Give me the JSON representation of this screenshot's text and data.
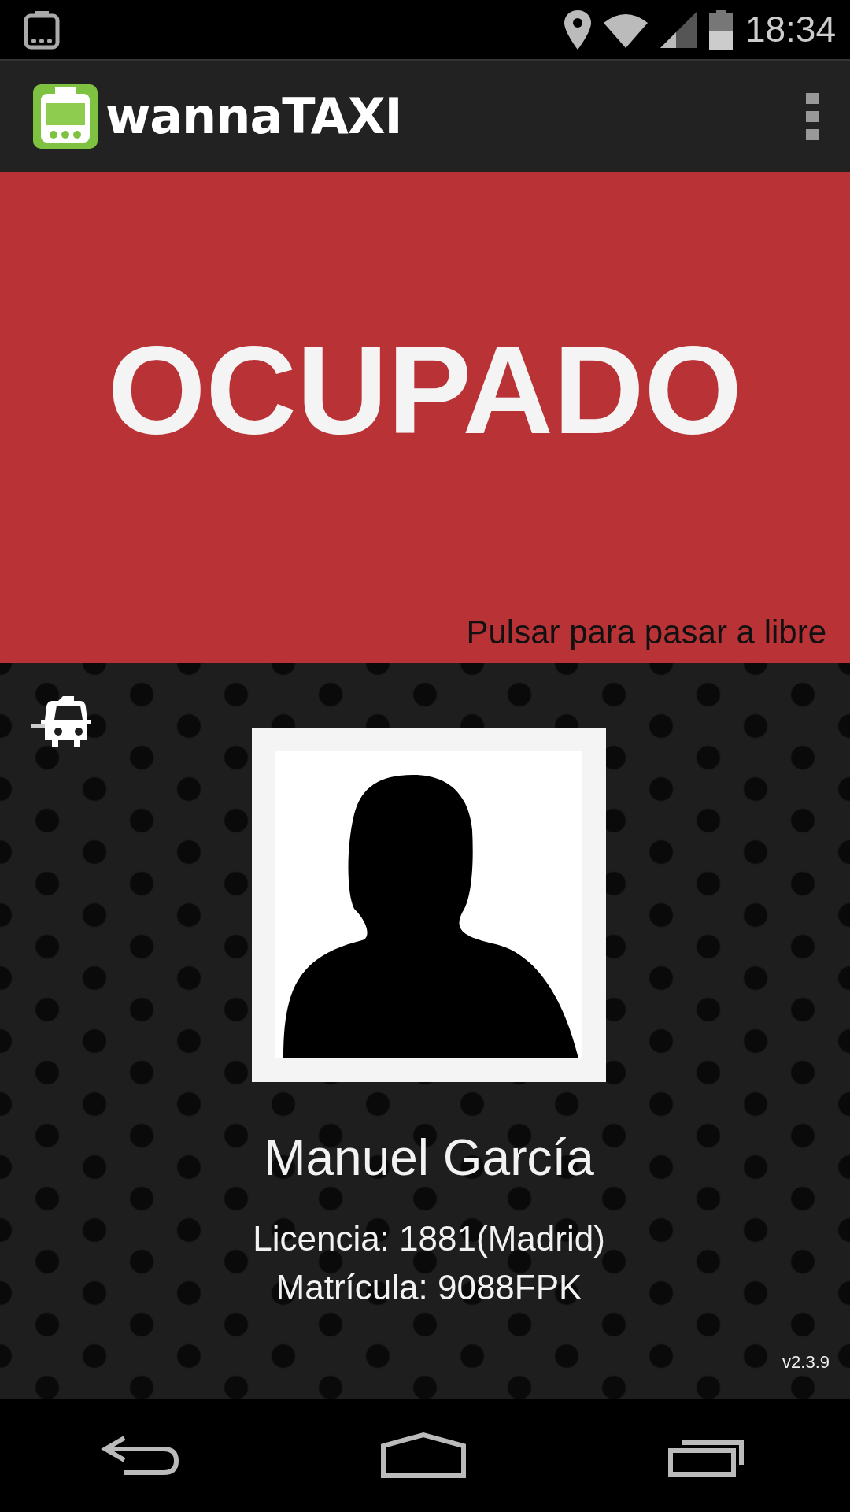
{
  "status_bar": {
    "time": "18:34"
  },
  "app_bar": {
    "logo": "wannaTAXI"
  },
  "state_panel": {
    "busy": true,
    "label": "OCUPADO",
    "hint": "Pulsar para pasar a libre"
  },
  "driver": {
    "name": "Manuel García",
    "license": "Licencia: 1881(Madrid)",
    "plate": "Matrícula: 9088FPK"
  },
  "version": "v2.3.9"
}
